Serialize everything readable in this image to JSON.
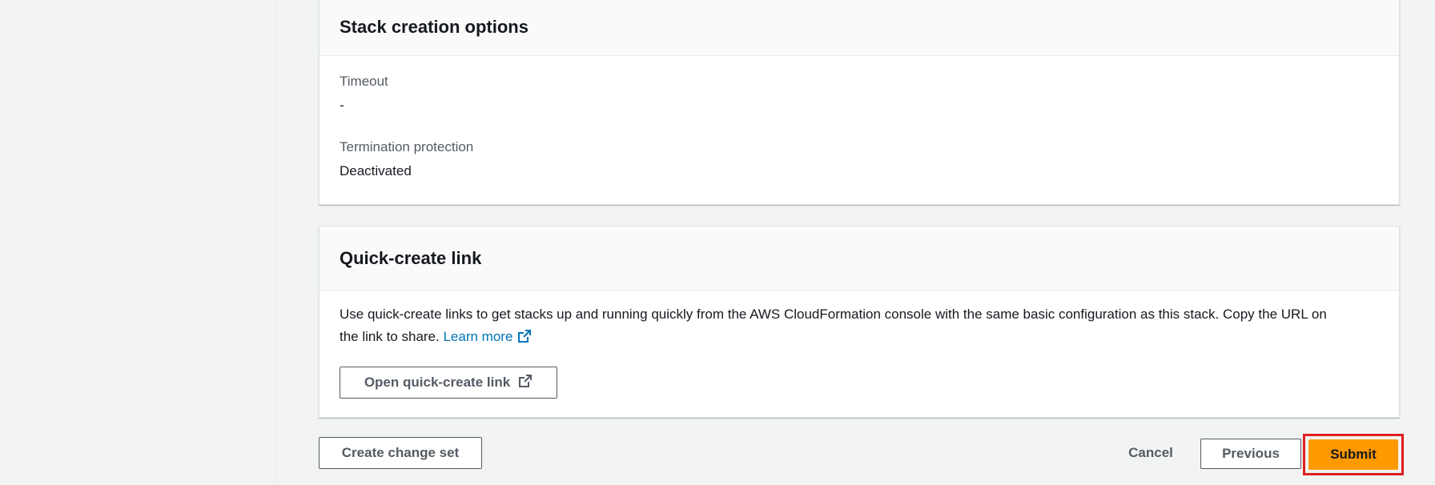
{
  "stack_options": {
    "title": "Stack creation options",
    "timeout_label": "Timeout",
    "timeout_value": "-",
    "termination_label": "Termination protection",
    "termination_value": "Deactivated"
  },
  "quick_create": {
    "title": "Quick-create link",
    "description_line1": "Use quick-create links to get stacks up and running quickly from the AWS CloudFormation console with the same basic configuration as this stack. Copy the URL on",
    "description_line2": "the link to share. ",
    "learn_more": "Learn more",
    "open_button": "Open quick-create link"
  },
  "footer": {
    "create_change_set": "Create change set",
    "cancel": "Cancel",
    "previous": "Previous",
    "submit": "Submit"
  },
  "colors": {
    "primary": "#ff9900",
    "link": "#0073bb",
    "highlight": "#e01f1f"
  },
  "icons": {
    "external_link": "external-link-icon"
  }
}
